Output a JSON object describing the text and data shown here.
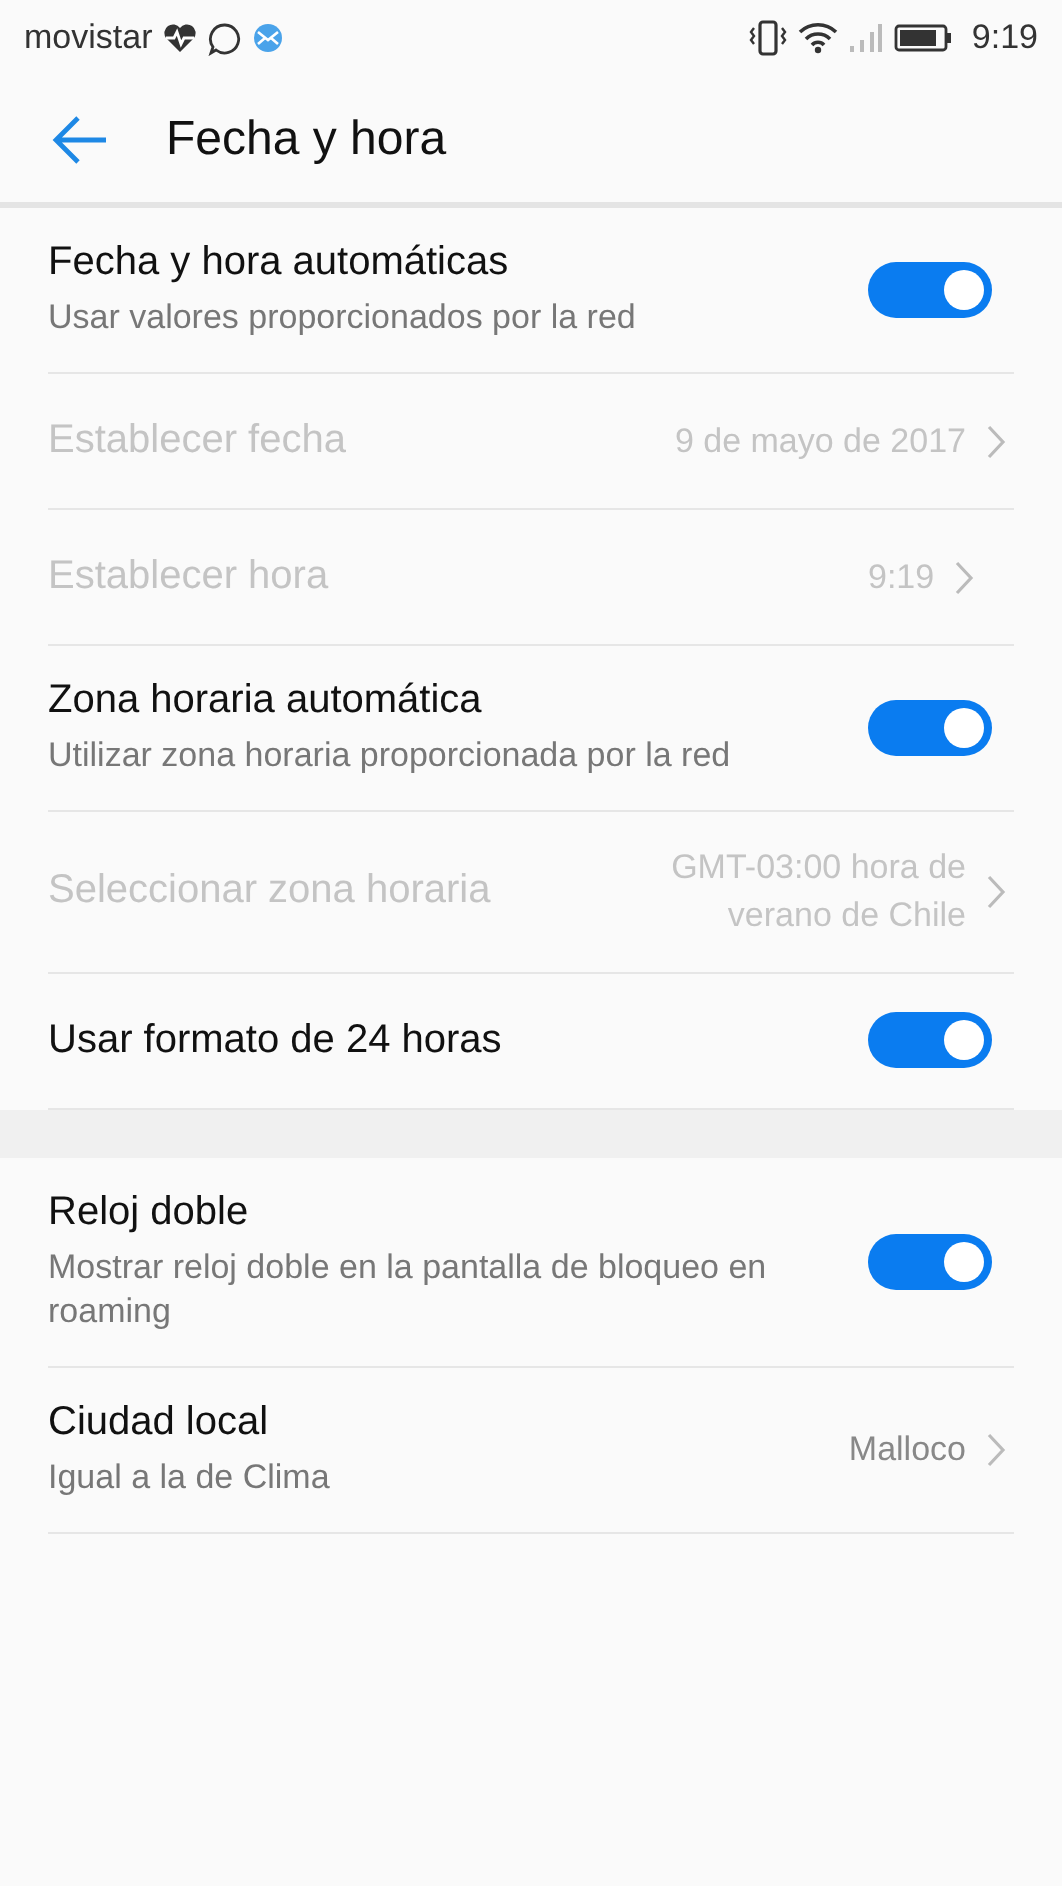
{
  "status_bar": {
    "carrier": "movistar",
    "time": "9:19"
  },
  "header": {
    "title": "Fecha y hora"
  },
  "sections": [
    {
      "items": [
        {
          "kind": "toggle",
          "title": "Fecha y hora automáticas",
          "subtitle": "Usar valores proporcionados por la red",
          "on": true,
          "disabled": false
        },
        {
          "kind": "link",
          "title": "Establecer fecha",
          "value": "9 de mayo de 2017",
          "disabled": true
        },
        {
          "kind": "link",
          "title": "Establecer hora",
          "value": "9:19",
          "disabled": true
        },
        {
          "kind": "toggle",
          "title": "Zona horaria automática",
          "subtitle": "Utilizar zona horaria proporcionada por la red",
          "on": true,
          "disabled": false
        },
        {
          "kind": "link",
          "title": "Seleccionar zona horaria",
          "value": "GMT-03:00 hora de verano de Chile",
          "disabled": true
        },
        {
          "kind": "toggle",
          "title": "Usar formato de 24 horas",
          "on": true,
          "disabled": false
        }
      ]
    },
    {
      "items": [
        {
          "kind": "toggle",
          "title": "Reloj doble",
          "subtitle": "Mostrar reloj doble en la pantalla de bloqueo en roaming",
          "on": true,
          "disabled": false
        },
        {
          "kind": "link",
          "title": "Ciudad local",
          "subtitle": "Igual a la de Clima",
          "value": "Malloco",
          "disabled": false
        }
      ]
    }
  ]
}
